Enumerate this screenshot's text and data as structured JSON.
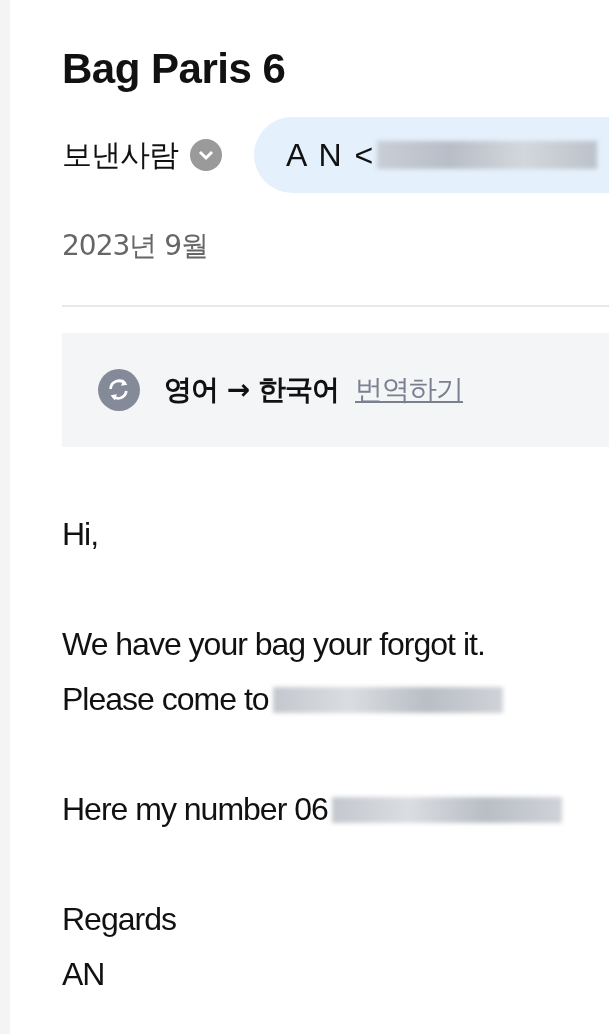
{
  "subject": "Bag Paris 6",
  "sender": {
    "label": "보낸사람",
    "name": "A N <"
  },
  "date": "2023년 9월",
  "translation": {
    "languages": "영어 → 한국어",
    "action": "번역하기"
  },
  "body": [
    {
      "kind": "text",
      "text": "Hi,"
    },
    {
      "kind": "gap"
    },
    {
      "kind": "text",
      "text": "We have your bag your forgot it."
    },
    {
      "kind": "redacted",
      "text": "Please come to"
    },
    {
      "kind": "gap"
    },
    {
      "kind": "redacted",
      "text": "Here my number 06"
    },
    {
      "kind": "gap"
    },
    {
      "kind": "text",
      "text": "Regards"
    },
    {
      "kind": "text",
      "text": "AN"
    }
  ]
}
